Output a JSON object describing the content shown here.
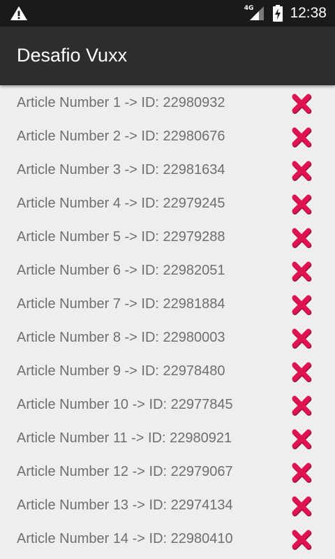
{
  "status_bar": {
    "network": "4G",
    "time": "12:38",
    "icons": [
      "warning-icon",
      "signal-icon",
      "battery-charging-icon"
    ]
  },
  "app_bar": {
    "title": "Desafio Vuxx"
  },
  "colors": {
    "status_bar": "#1a1a1a",
    "app_bar": "#2d2d30",
    "background": "#eeeeee",
    "item_text": "#6f6f6f",
    "delete_icon": "#e0124f"
  },
  "articles": [
    {
      "label": "Article Number 1 -> ID: 22980932",
      "icon": "close-icon"
    },
    {
      "label": "Article Number 2 -> ID: 22980676",
      "icon": "close-icon"
    },
    {
      "label": "Article Number 3 -> ID: 22981634",
      "icon": "close-icon"
    },
    {
      "label": "Article Number 4 -> ID: 22979245",
      "icon": "close-icon"
    },
    {
      "label": "Article Number 5 -> ID: 22979288",
      "icon": "close-icon"
    },
    {
      "label": "Article Number 6 -> ID: 22982051",
      "icon": "close-icon"
    },
    {
      "label": "Article Number 7 -> ID: 22981884",
      "icon": "close-icon"
    },
    {
      "label": "Article Number 8 -> ID: 22980003",
      "icon": "close-icon"
    },
    {
      "label": "Article Number 9 -> ID: 22978480",
      "icon": "close-icon"
    },
    {
      "label": "Article Number 10 -> ID: 22977845",
      "icon": "close-icon"
    },
    {
      "label": "Article Number 11 -> ID: 22980921",
      "icon": "close-icon"
    },
    {
      "label": "Article Number 12 -> ID: 22979067",
      "icon": "close-icon"
    },
    {
      "label": "Article Number 13 -> ID: 22974134",
      "icon": "close-icon"
    },
    {
      "label": "Article Number 14 -> ID: 22980410",
      "icon": "close-icon"
    }
  ]
}
